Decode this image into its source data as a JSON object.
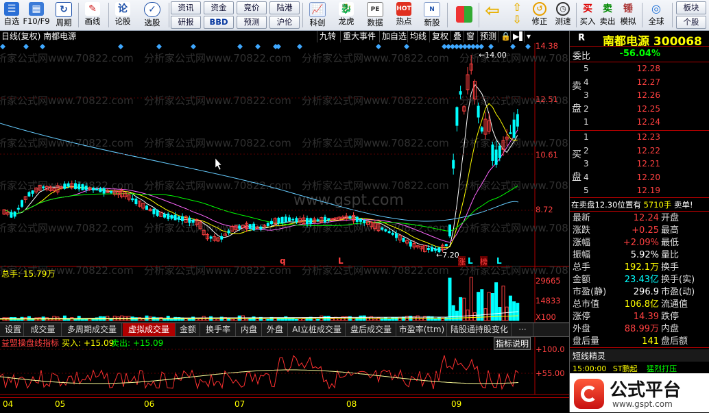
{
  "toolbar": {
    "buttons": [
      {
        "label": "自选",
        "icon": "star-list-icon"
      },
      {
        "label": "F10/F9",
        "icon": "f10-icon"
      },
      {
        "label": "周期",
        "icon": "period-icon"
      },
      {
        "label": "画线",
        "icon": "pencil-icon"
      },
      {
        "label": "论股",
        "icon": "discuss-icon"
      },
      {
        "label": "选股",
        "icon": "select-stock-icon"
      }
    ],
    "mini_buttons": [
      "资讯",
      "资金",
      "竞价",
      "陆港",
      "研报",
      "BBD",
      "预测",
      "沪伦"
    ],
    "buttons2": [
      {
        "label": "科创",
        "icon": "kechuang-icon"
      },
      {
        "label": "龙虎",
        "icon": "dragon-tiger-icon"
      },
      {
        "label": "数据",
        "icon": "data-icon"
      },
      {
        "label": "热点",
        "icon": "hot-icon"
      },
      {
        "label": "新股",
        "icon": "new-stock-icon"
      }
    ],
    "buttons3": [
      {
        "label": "修正",
        "icon": "revise-icon"
      },
      {
        "label": "测速",
        "icon": "speedtest-icon"
      }
    ],
    "trade_buttons": [
      {
        "icon_text": "买",
        "label": "买入"
      },
      {
        "icon_text": "卖",
        "label": "卖出"
      },
      {
        "icon_text": "锤",
        "label": "模拟"
      },
      {
        "icon_text": "◎",
        "label": "全球"
      }
    ],
    "sector": {
      "top": "板块",
      "bottom": "个股"
    }
  },
  "chart_header": {
    "title": "日线(复权) 南都电源",
    "tabs": [
      "九转",
      "重大事件",
      "加自选",
      "均线",
      "复权",
      "叠",
      "窗",
      "预测",
      "🔒",
      "▶▌",
      "▾"
    ]
  },
  "price_axis": [
    "14.38",
    "12.51",
    "10.61",
    "8.72"
  ],
  "annotations": {
    "high": "14.00",
    "low": "7.20",
    "markers": [
      "q",
      "L",
      "涨",
      "L",
      "榜",
      "L"
    ]
  },
  "volume": {
    "label": "总手: 15.79万",
    "axis": [
      "29665",
      "14833",
      "X100"
    ]
  },
  "indicator_tabs": [
    "设置",
    "成交量",
    "多周期成交量",
    "虚拟成交量",
    "金额",
    "换手率",
    "内盘",
    "外盘",
    "AI立桩成交量",
    "盘后成交量",
    "市盈率(ttm)",
    "陆股通持股变化",
    "···"
  ],
  "active_tab": "虚拟成交量",
  "indicator": {
    "name": "益盟操盘线指标",
    "buy": "买入: +15.09",
    "sell": "卖出: +15.09",
    "help": "指标说明",
    "axis": [
      "+100.0",
      "+55.00"
    ]
  },
  "xaxis": [
    "04",
    "05",
    "06",
    "07",
    "08",
    "09"
  ],
  "watermarks": {
    "text": "分析家公式网www.70822.com",
    "center": "www.gspt.com"
  },
  "quote": {
    "code_label": "R",
    "name": "南都电源 300068",
    "wei_bi_label": "委比",
    "wei_bi": "-56.04%",
    "sell_side_label": [
      "卖",
      "盘"
    ],
    "buy_side_label": [
      "买",
      "盘"
    ],
    "asks": [
      {
        "lvl": "5",
        "price": "12.28"
      },
      {
        "lvl": "4",
        "price": "12.27"
      },
      {
        "lvl": "3",
        "price": "12.26"
      },
      {
        "lvl": "2",
        "price": "12.25"
      },
      {
        "lvl": "1",
        "price": "12.24"
      }
    ],
    "bids": [
      {
        "lvl": "1",
        "price": "12.23"
      },
      {
        "lvl": "2",
        "price": "12.22"
      },
      {
        "lvl": "3",
        "price": "12.21"
      },
      {
        "lvl": "4",
        "price": "12.20"
      },
      {
        "lvl": "5",
        "price": "12.19"
      }
    ],
    "sell_note": "在卖盘12.30位置有",
    "sell_note_vol": "5710手",
    "sell_note_tag": "卖单!",
    "fields": [
      {
        "l": "最新",
        "v": "12.24",
        "r": "开盘",
        "c": "#ff4040"
      },
      {
        "l": "涨跌",
        "v": "+0.25",
        "r": "最高",
        "c": "#ff4040"
      },
      {
        "l": "涨幅",
        "v": "+2.09%",
        "r": "最低",
        "c": "#ff4040"
      },
      {
        "l": "振幅",
        "v": "5.92%",
        "r": "量比",
        "c": "#ffffff"
      },
      {
        "l": "总手",
        "v": "192.1万",
        "r": "换手",
        "c": "#ffff00"
      },
      {
        "l": "金额",
        "v": "23.43亿",
        "r": "换手(实)",
        "c": "#00ffff"
      },
      {
        "l": "市盈(静)",
        "v": "296.9",
        "r": "市盈(动)",
        "c": "#ffffff"
      },
      {
        "l": "总市值",
        "v": "106.8亿",
        "r": "流通值",
        "c": "#ffff00"
      },
      {
        "l": "涨停",
        "v": "14.39",
        "r": "跌停",
        "c": "#ff4040"
      },
      {
        "l": "外盘",
        "v": "88.99万",
        "r": "内盘",
        "c": "#ff4040"
      },
      {
        "l": "盘后量",
        "v": "141",
        "r": "盘后额",
        "c": "#ffff00"
      }
    ],
    "short_wizard": "短线精灵",
    "wizard_time": "15:00:00",
    "wizard_name": "ST鹏起",
    "wizard_event": "猛烈打压",
    "logo_text": "公式平台",
    "logo_url": "www.gspt.com"
  },
  "colors": {
    "up": "#ff4040",
    "down": "#00ffff",
    "ma5": "#ffffff",
    "ma10": "#ffff00",
    "ma20": "#ff66ff",
    "ma30": "#00ff00",
    "ma60": "#66ccff"
  }
}
